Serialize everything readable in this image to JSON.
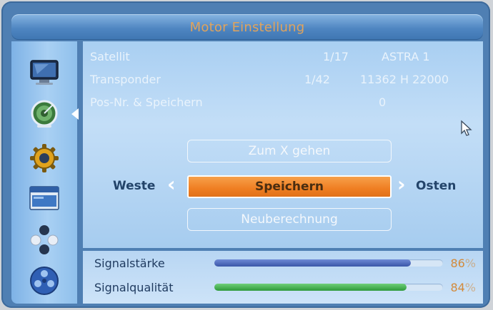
{
  "window": {
    "title": "Motor Einstellung"
  },
  "sidebar": {
    "items": [
      {
        "icon": "tv-icon"
      },
      {
        "icon": "satellite-dish-icon",
        "selected": true
      },
      {
        "icon": "gear-icon"
      },
      {
        "icon": "window-app-icon"
      },
      {
        "icon": "game-pad-icon"
      },
      {
        "icon": "media-reel-icon"
      }
    ]
  },
  "info": {
    "satellite_label": "Satellit",
    "satellite_index": "1/17",
    "satellite_name": "ASTRA 1",
    "transponder_label": "Transponder",
    "transponder_index": "1/42",
    "transponder_value": "11362 H 22000",
    "posnr_label": "Pos-Nr. & Speichern",
    "posnr_value": "0"
  },
  "controls": {
    "goto_x_label": "Zum X gehen",
    "save_label": "Speichern",
    "recalc_label": "Neuberechnung",
    "west_label": "Weste",
    "east_label": "Osten"
  },
  "signal": {
    "strength_label": "Signalstärke",
    "strength_value": "86",
    "strength_fraction": 0.86,
    "quality_label": "Signalqualität",
    "quality_value": "84",
    "quality_fraction": 0.84,
    "percent_sign": "%"
  },
  "colors": {
    "strength_bar": "#3a56a8",
    "quality_bar": "#2f9a3a",
    "accent_orange": "#ef7e22"
  }
}
